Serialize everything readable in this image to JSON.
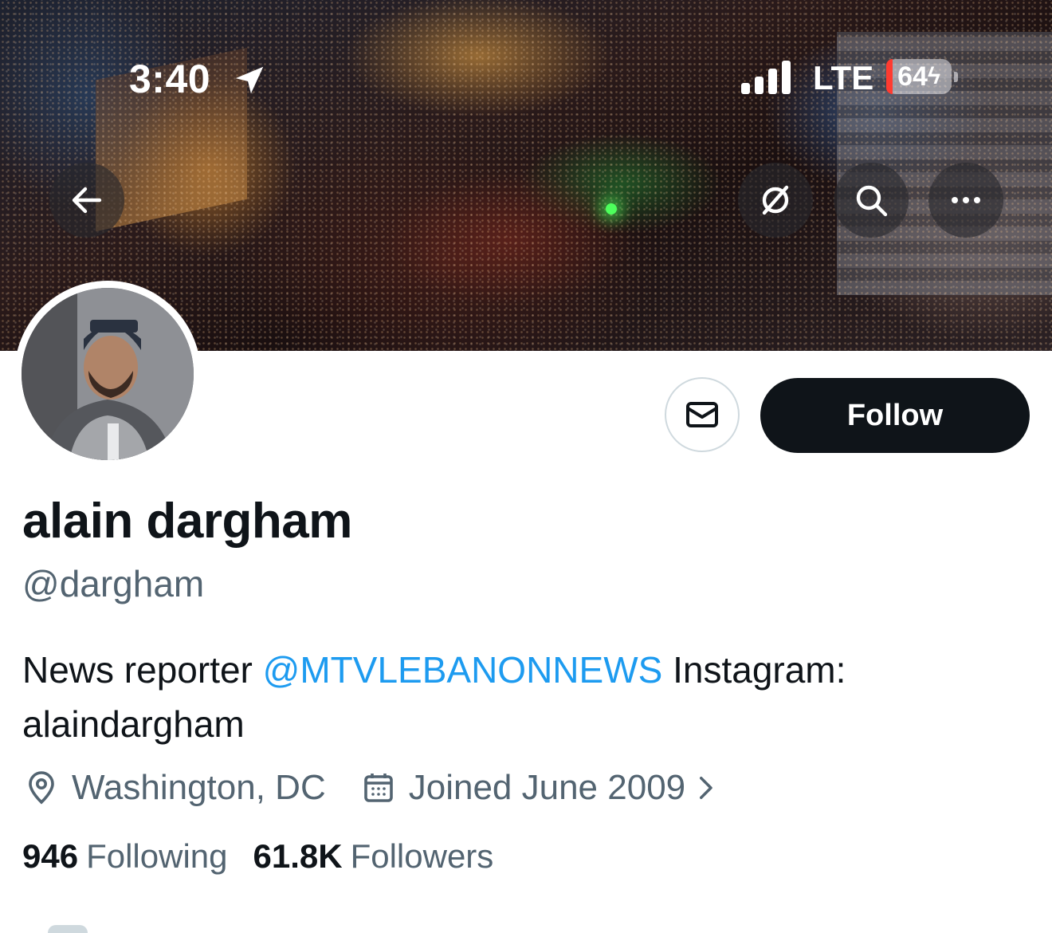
{
  "status_bar": {
    "time": "3:40",
    "network": "LTE",
    "battery": "64"
  },
  "banner": {
    "icons": [
      "back-arrow-icon",
      "grok-icon",
      "search-icon",
      "more-icon"
    ]
  },
  "profile": {
    "name": "alain dargham",
    "handle": "@dargham",
    "bio_text": "News reporter ",
    "bio_mention": "@MTVLEBANONNEWS",
    "bio_rest": " Instagram: alaindargham",
    "location": "Washington, DC",
    "joined": "Joined June 2009",
    "following_count": "946",
    "following_label": "Following",
    "followers_count": "61.8K",
    "followers_label": "Followers"
  },
  "actions": {
    "follow_label": "Follow"
  },
  "colors": {
    "accent": "#1d9bf0",
    "primary_text": "#0f1419",
    "secondary_text": "#536471",
    "follow_bg": "#0f1419"
  }
}
